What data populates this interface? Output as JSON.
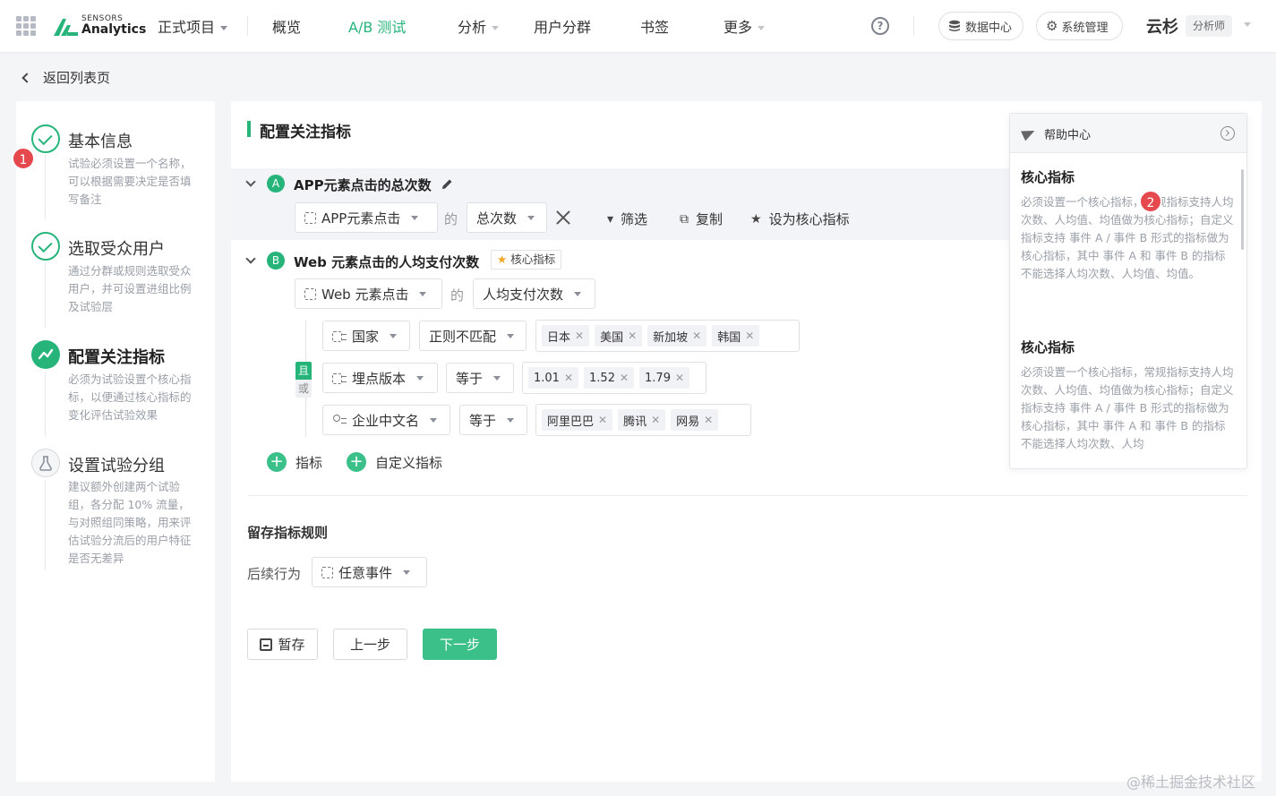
{
  "topbar": {
    "logo_top": "SENSORS",
    "logo_bottom": "Analytics",
    "project": "正式项目",
    "nav": [
      "概览",
      "A/B 测试",
      "分析",
      "用户分群",
      "书签",
      "更多"
    ],
    "help": "?",
    "data_center": "数据中心",
    "system_admin": "系统管理",
    "user": "云杉",
    "role": "分析师"
  },
  "back_label": "返回列表页",
  "steps": [
    {
      "title": "基本信息",
      "desc": "试验必须设置一个名称，可以根据需要决定是否填写备注"
    },
    {
      "title": "选取受众用户",
      "desc": "通过分群或规则选取受众用户，并可设置进组比例及试验层"
    },
    {
      "title": "配置关注指标",
      "desc": "必须为试验设置个核心指标，以便通过核心指标的变化评估试验效果"
    },
    {
      "title": "设置试验分组",
      "desc": "建议额外创建两个试验组，各分配 10% 流量，与对照组同策略，用来评估试验分流后的用户特征是否无差异"
    }
  ],
  "badges": {
    "one": "1",
    "two": "2"
  },
  "section_title": "配置关注指标",
  "metric_a": {
    "letter": "A",
    "title": "APP元素点击的总次数",
    "event": "APP元素点击",
    "of": "的",
    "agg": "总次数",
    "filter": "筛选",
    "copy": "复制",
    "set_core": "设为核心指标"
  },
  "metric_b": {
    "letter": "B",
    "title": "Web 元素点击的人均支付次数",
    "core_badge": "核心指标",
    "event": "Web 元素点击",
    "of": "的",
    "agg": "人均支付次数",
    "and": "且",
    "or": "或",
    "conditions": [
      {
        "field": "国家",
        "op": "正则不匹配",
        "values": [
          "日本",
          "美国",
          "新加坡",
          "韩国"
        ]
      },
      {
        "field": "埋点版本",
        "op": "等于",
        "values": [
          "1.01",
          "1.52",
          "1.79"
        ]
      },
      {
        "field": "企业中文名",
        "op": "等于",
        "values": [
          "阿里巴巴",
          "腾讯",
          "网易"
        ]
      }
    ]
  },
  "add_metric": "指标",
  "add_custom": "自定义指标",
  "retention_title": "留存指标规则",
  "follow_label": "后续行为",
  "follow_value": "任意事件",
  "buttons": {
    "save": "暂存",
    "prev": "上一步",
    "next": "下一步"
  },
  "help": {
    "title": "帮助中心",
    "sections": [
      {
        "heading": "核心指标",
        "body": "必须设置一个核心指标，常规指标支持人均次数、人均值、均值做为核心指标；自定义指标支持 事件 A / 事件 B 形式的指标做为核心指标，其中 事件 A 和 事件 B 的指标不能选择人均次数、人均值、均值。"
      },
      {
        "heading": "核心指标",
        "body": "必须设置一个核心指标，常规指标支持人均次数、人均值、均值做为核心指标；自定义指标支持 事件 A / 事件 B 形式的指标做为核心指标，其中 事件 A 和 事件 B 的指标不能选择人均次数、人均"
      }
    ]
  },
  "watermark": "@稀土掘金技术社区",
  "colors": {
    "accent": "#26b47a",
    "badge": "#e5484d"
  }
}
